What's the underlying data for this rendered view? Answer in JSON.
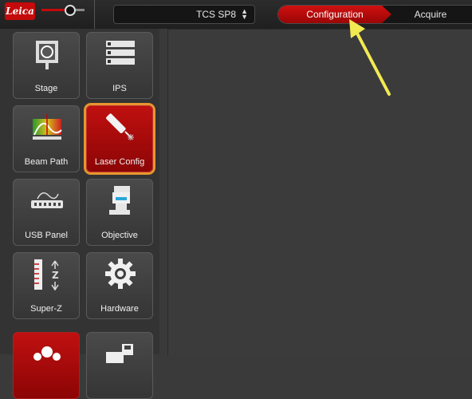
{
  "header": {
    "logo_text": "Leica",
    "zoom_level": 0.67,
    "system_name": "TCS SP8",
    "workflow_tabs": [
      "Configuration",
      "Acquire"
    ]
  },
  "sidebar": {
    "tiles": [
      {
        "label": "Stage",
        "icon": "stage-icon"
      },
      {
        "label": "IPS",
        "icon": "list-icon"
      },
      {
        "label": "Beam Path",
        "icon": "spectrum-icon"
      },
      {
        "label": "Laser Config",
        "icon": "laser-icon",
        "active": true
      },
      {
        "label": "USB Panel",
        "icon": "usb-panel-icon"
      },
      {
        "label": "Objective",
        "icon": "objective-icon"
      },
      {
        "label": "Super-Z",
        "icon": "super-z-icon"
      },
      {
        "label": "Hardware",
        "icon": "gear-icon"
      }
    ]
  },
  "annotation": {
    "arrow_color": "#f2ea52",
    "highlight_color": "#e8962c"
  },
  "colors": {
    "accent": "#c40a0a"
  }
}
